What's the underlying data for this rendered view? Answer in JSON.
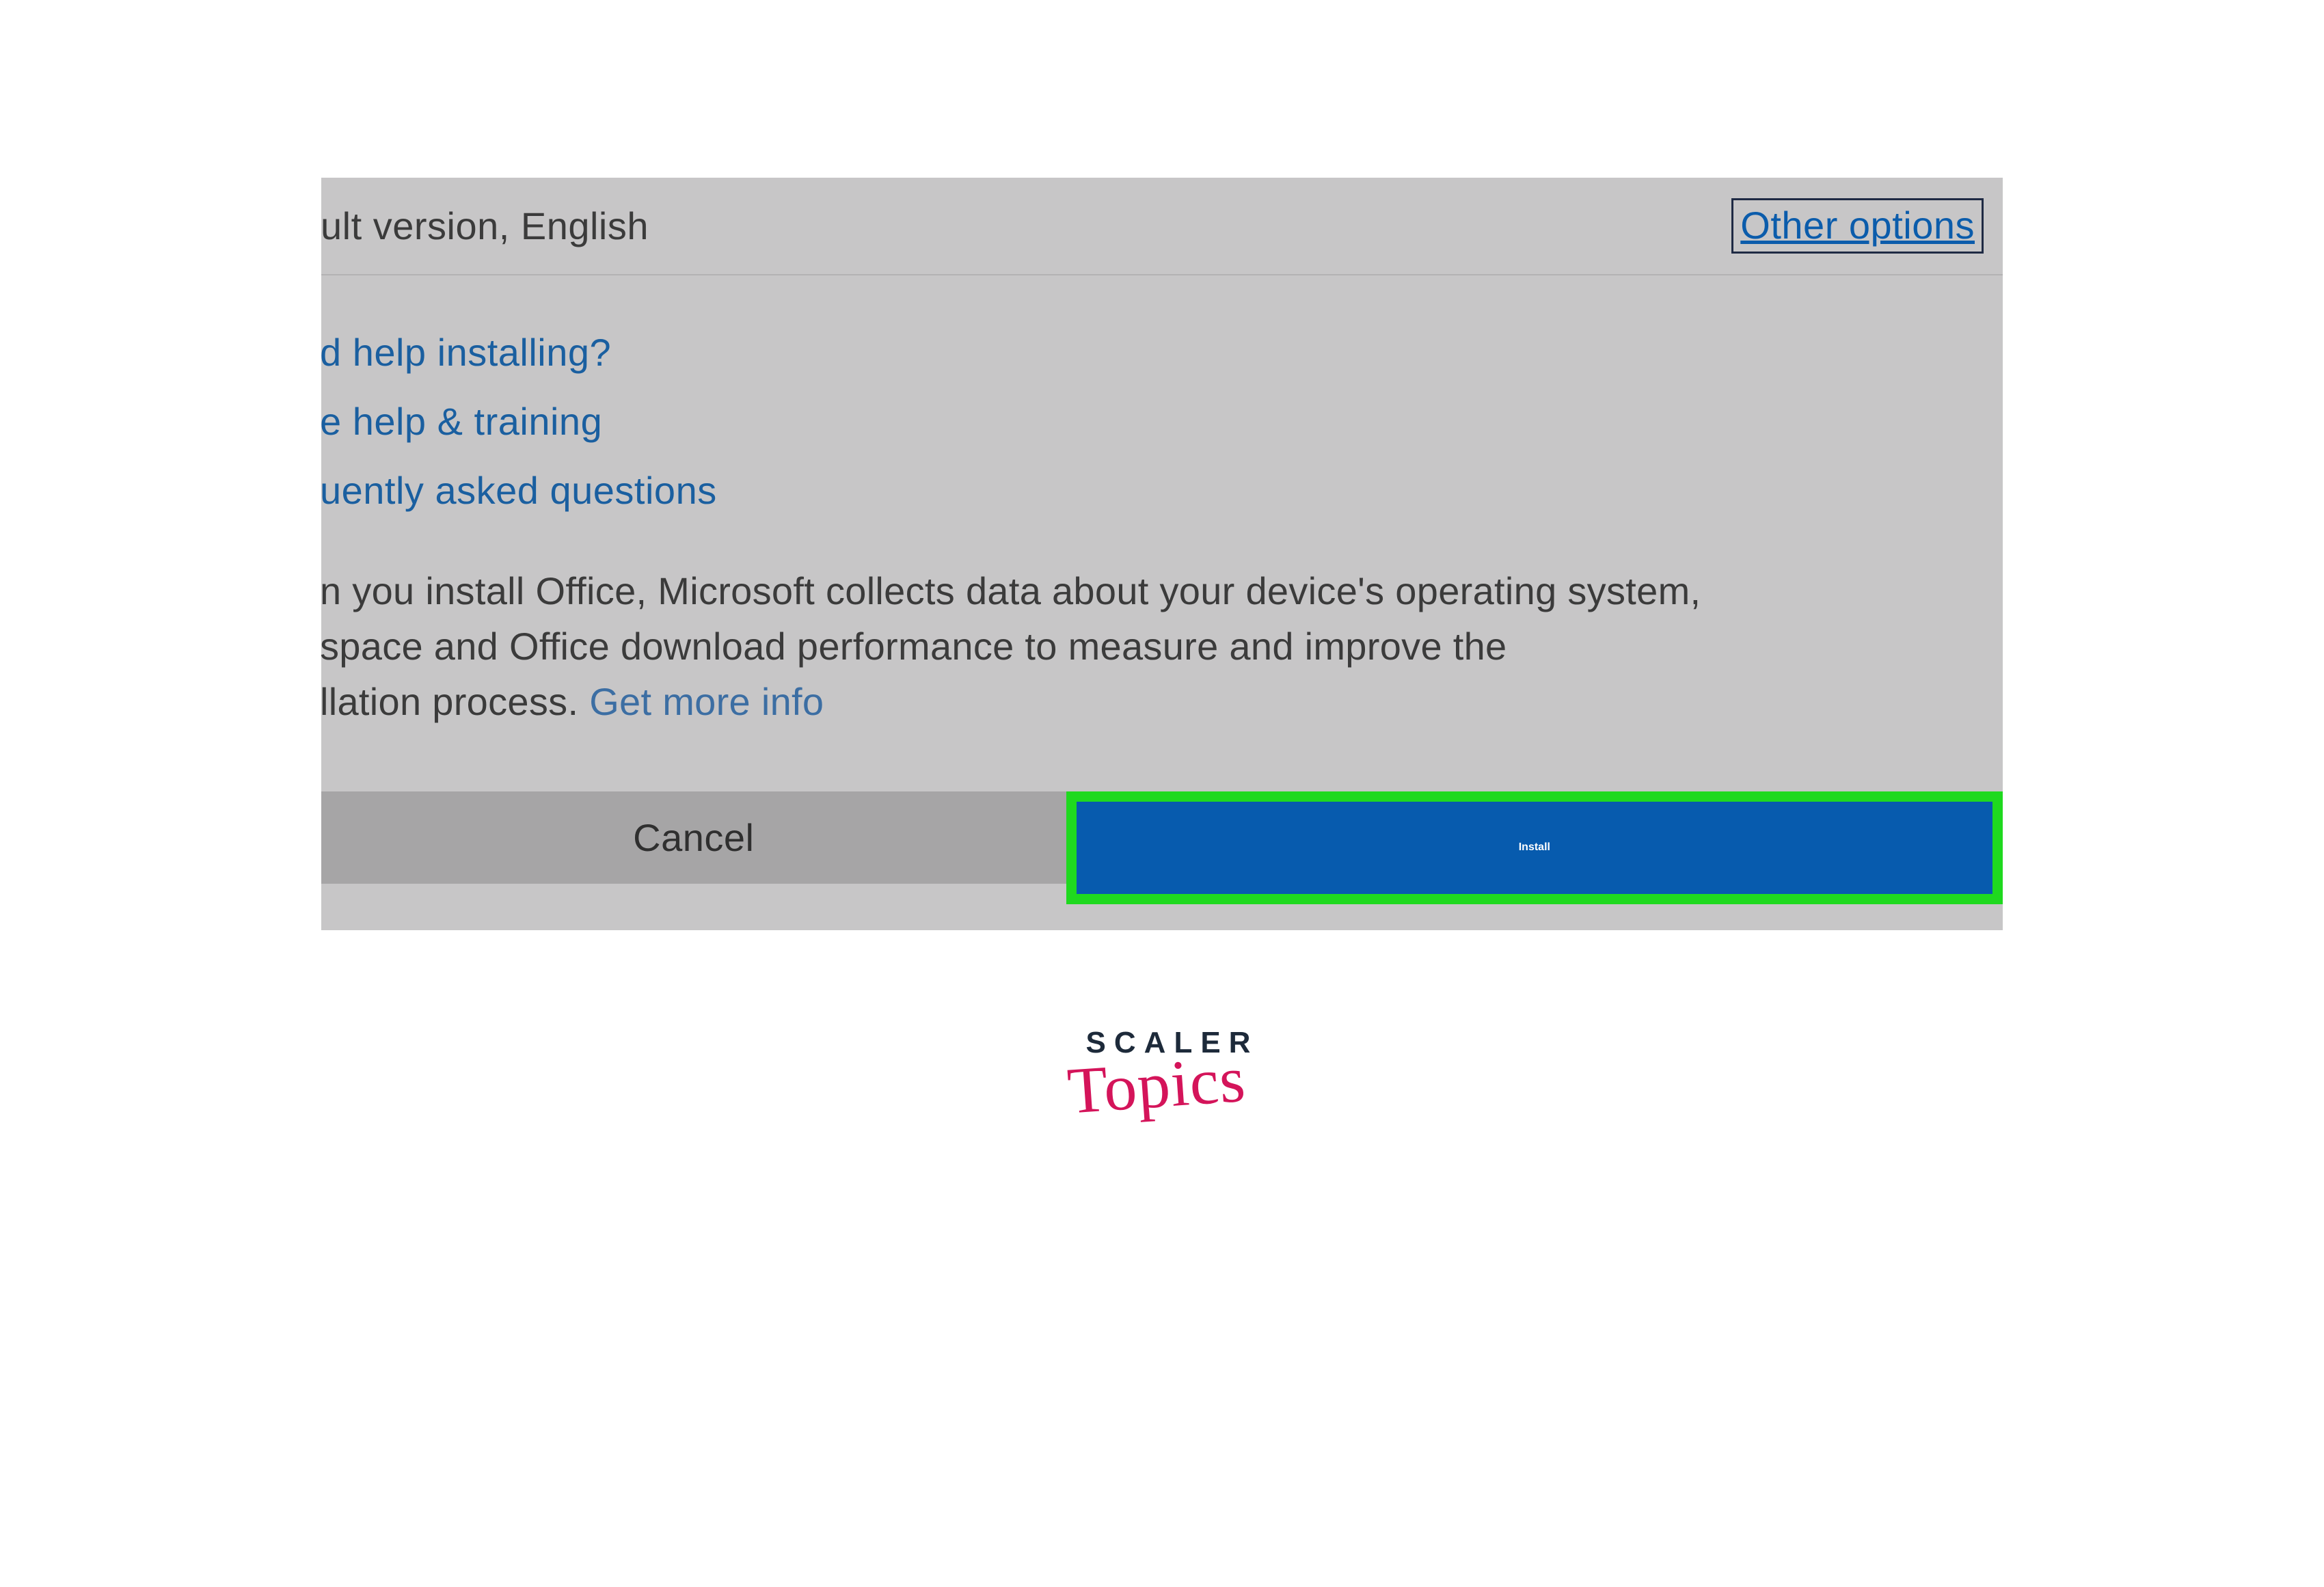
{
  "header": {
    "version_text": "ult version, English",
    "other_options": "Other options"
  },
  "links": {
    "need_help": "d help installing?",
    "help_training": "e help & training",
    "faq": "uently asked questions"
  },
  "body": {
    "line1": "n you install Office, Microsoft collects data about your device's operating system,",
    "line2": "space and Office download performance to measure and improve the",
    "line3_a": "llation process. ",
    "more_info": "Get more info"
  },
  "buttons": {
    "cancel": "Cancel",
    "install": "Install"
  },
  "logo": {
    "top": "SCALER",
    "bottom": "Topics"
  }
}
